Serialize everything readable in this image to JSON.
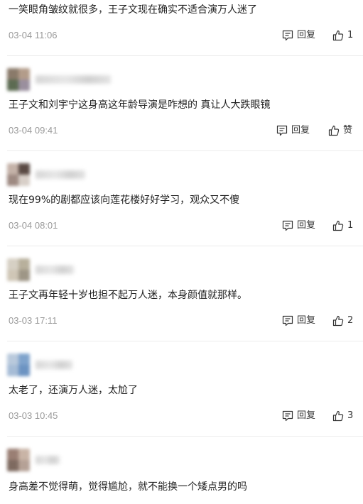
{
  "comments": [
    {
      "text": "一笑眼角皱纹就很多，王子文现在确实不适合演万人迷了",
      "time": "03-04 11:06",
      "reply_label": "回复",
      "like_label": "1",
      "avatar": null
    },
    {
      "text": "王子文和刘宇宁这身高这年龄导演是咋想的 真让人大跌眼镜",
      "time": "03-04 09:41",
      "reply_label": "回复",
      "like_label": "赞",
      "avatar": {
        "colors": [
          "#8a7a6a",
          "#b39c8a",
          "#5c6b52",
          "#9a8f9e"
        ]
      }
    },
    {
      "text": "现在99%的剧都应该向莲花楼好好学习，观众又不傻",
      "time": "03-04 08:01",
      "reply_label": "回复",
      "like_label": "1",
      "avatar": {
        "colors": [
          "#c4b2a8",
          "#5a4a44",
          "#9e8a82",
          "#d8cfc8"
        ]
      }
    },
    {
      "text": "王子文再年轻十岁也担不起万人迷，本身颜值就那样。",
      "time": "03-03 17:11",
      "reply_label": "回复",
      "like_label": "2",
      "avatar": {
        "colors": [
          "#d6d0c4",
          "#b8b09c",
          "#cfc6b6",
          "#9e9686"
        ]
      }
    },
    {
      "text": "太老了，还演万人迷，太尬了",
      "time": "03-03 10:45",
      "reply_label": "回复",
      "like_label": "3",
      "avatar": {
        "colors": [
          "#b9c9dc",
          "#7fa3cc",
          "#a6bcd6",
          "#6c93c2"
        ]
      }
    },
    {
      "text": "身高差不觉得萌，觉得尴尬，就不能换一个矮点男的吗",
      "time": null,
      "reply_label": null,
      "like_label": null,
      "avatar": {
        "colors": [
          "#9a7f74",
          "#c9b4a6",
          "#7e6a60",
          "#b5a196"
        ]
      }
    }
  ]
}
